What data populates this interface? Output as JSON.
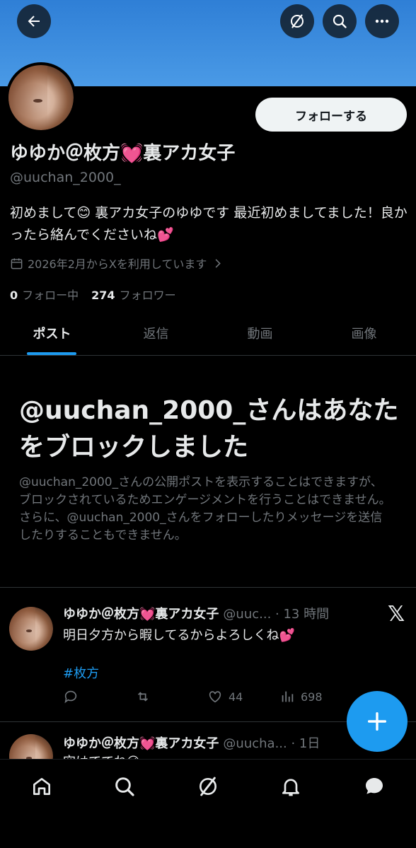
{
  "profile": {
    "display_name": "ゆゆか＠枚方💓裏アカ女子",
    "handle": "@uuchan_2000_",
    "bio": "初めまして😊 裏アカ女子のゆゆです 最近初めましてました！良かったら絡んでくださいね💕",
    "joined": "2026年2月からXを利用しています",
    "following_count": "0",
    "following_label": "フォロー中",
    "followers_count": "274",
    "followers_label": "フォロワー",
    "follow_button": "フォローする"
  },
  "tabs": [
    {
      "label": "ポスト",
      "active": true
    },
    {
      "label": "返信",
      "active": false
    },
    {
      "label": "動画",
      "active": false
    },
    {
      "label": "画像",
      "active": false
    }
  ],
  "blocked": {
    "title": "@uuchan_2000_さんはあなたをブロックしました",
    "message": "@uuchan_2000_さんの公開ポストを表示することはできますが、ブロックされているためエンゲージメントを行うことはできません。さらに、@uuchan_2000_さんをフォローしたりメッセージを送信したりすることもできません。"
  },
  "posts": [
    {
      "name": "ゆゆか＠枚方💓裏アカ女子",
      "handle_time": "@uuc... · 13 時間",
      "text": "明日夕方から暇してるからよろしくね💕",
      "hashtag": "#枚方",
      "likes": "44",
      "views": "698"
    },
    {
      "name": "ゆゆか＠枚方💓裏アカ女子",
      "handle_time": "@uucha... · 1日",
      "text": "空はててね😉"
    }
  ],
  "icons": {
    "back": "back-arrow-icon",
    "grok": "grok-icon",
    "search": "search-icon",
    "more": "more-icon",
    "x_logo": "𝕏"
  },
  "colors": {
    "accent": "#1d9bf0",
    "banner": "#3a8ee2",
    "background": "#000000"
  }
}
